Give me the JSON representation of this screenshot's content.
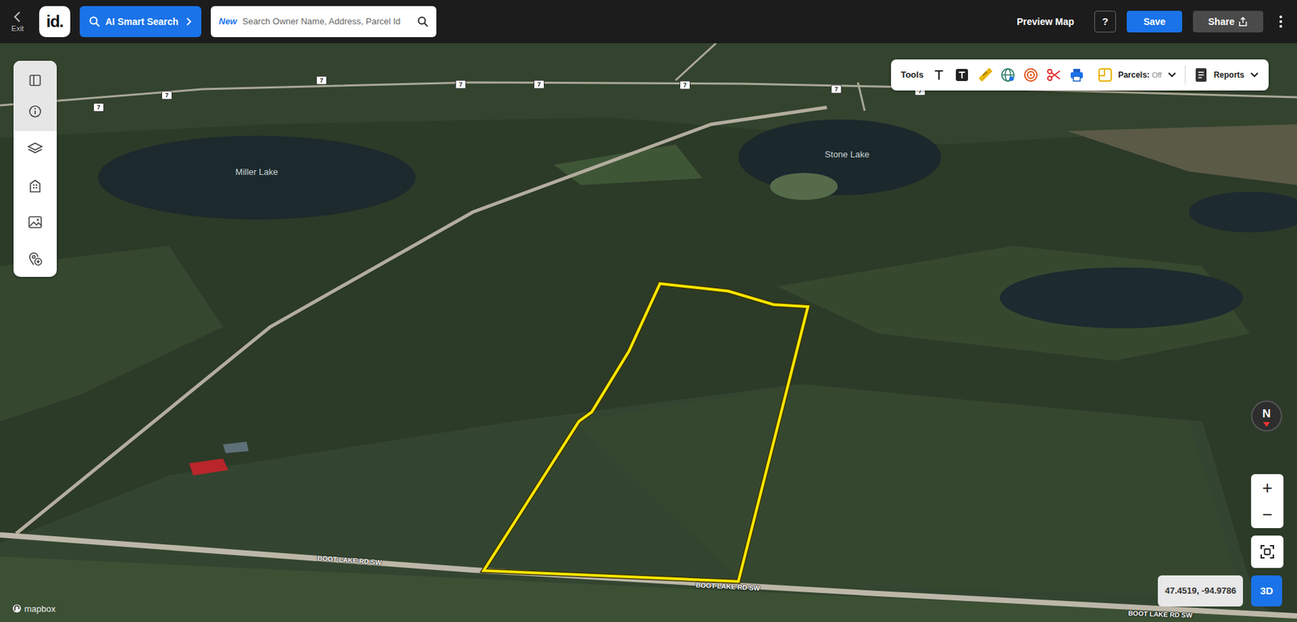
{
  "topbar": {
    "back_label": "Exit",
    "logo": "id.",
    "ai_search": "AI Smart Search",
    "search": {
      "badge": "New",
      "placeholder": "Search Owner Name, Address, Parcel Id"
    },
    "preview": "Preview Map",
    "help": "?",
    "save": "Save",
    "share": "Share"
  },
  "tools": {
    "label": "Tools",
    "parcels": {
      "label": "Parcels:",
      "value": "Off"
    },
    "reports": "Reports"
  },
  "map": {
    "lakes": [
      "Miller Lake",
      "Stone Lake"
    ],
    "roads": [
      "BOOT LAKE RD SW",
      "BOOT LAKE RD SW",
      "BOOT LAKE RD SW"
    ],
    "shields": [
      "7",
      "7",
      "7",
      "7",
      "7",
      "7",
      "7",
      "7"
    ]
  },
  "compass": "N",
  "zoom": {
    "in": "+",
    "out": "−"
  },
  "coordinates": "47.4519, -94.9786",
  "view_mode": "3D",
  "attribution": "mapbox"
}
